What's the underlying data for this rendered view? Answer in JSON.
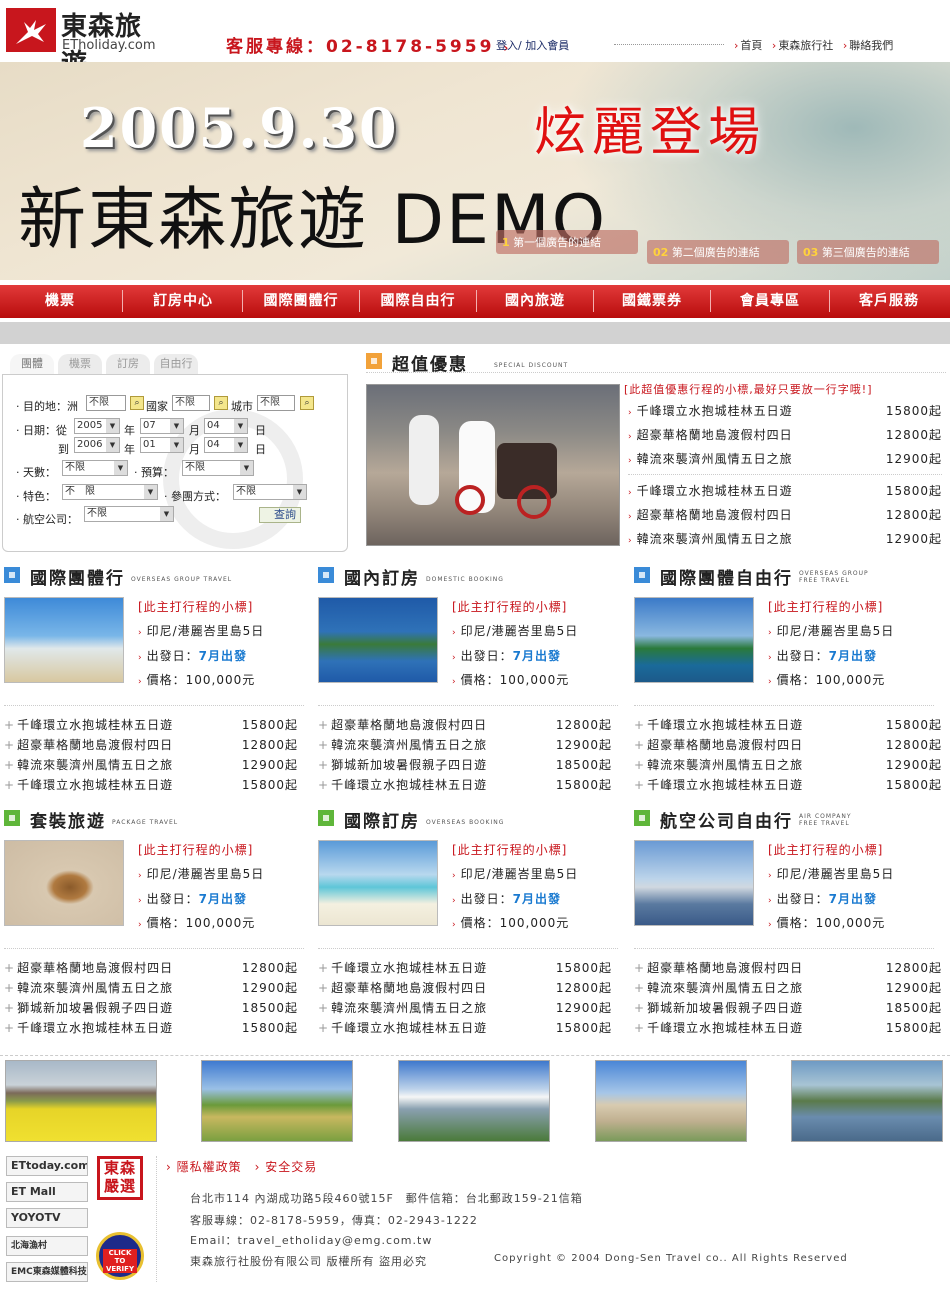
{
  "brand": {
    "name_zh": "東森旅遊",
    "name_en": "ETholiday.com"
  },
  "header": {
    "hotline": "客服專線：02-8178-5959",
    "login": "登入",
    "join": "加入會員",
    "nav": [
      "首頁",
      "東森旅行社",
      "聯絡我們"
    ]
  },
  "banner": {
    "date": "2005.9.30",
    "show": "炫麗登場",
    "title": "新東森旅遊 DEMO",
    "ads": [
      {
        "num": "1",
        "text": "第一個廣告的連結"
      },
      {
        "num": "02",
        "text": "第二個廣告的連結"
      },
      {
        "num": "03",
        "text": "第三個廣告的連結"
      }
    ]
  },
  "menu": [
    "機票",
    "訂房中心",
    "國際團體行",
    "國際自由行",
    "國內旅遊",
    "國鐵票券",
    "會員專區",
    "客戶服務"
  ],
  "search": {
    "tabs": [
      "團體",
      "機票",
      "訂房",
      "自由行"
    ],
    "dest_label": "目的地：洲",
    "dest_continent": "不限",
    "country_label": "國家",
    "country": "不限",
    "city_label": "城市",
    "city": "不限",
    "date_label": "日期：從",
    "to_label": "到",
    "from_year": "2005",
    "from_month": "07",
    "from_day": "04",
    "to_year": "2006",
    "to_month": "01",
    "to_day": "04",
    "year_unit": "年",
    "month_unit": "月",
    "day_unit": "日",
    "days_label": "天數：",
    "days": "不限",
    "budget_label": "預算：",
    "budget": "不限",
    "feature_label": "特色：",
    "feature": "不　限",
    "join_label": "參團方式：",
    "join": "不限",
    "airline_label": "航空公司：",
    "airline": "不限",
    "query": "查詢"
  },
  "special": {
    "title": "超值優惠",
    "en": "SPECIAL DISCOUNT",
    "subtitle": "[此超值優惠行程的小標,最好只要放一行字哦!]",
    "items": [
      {
        "name": "千峰環立水抱城桂林五日遊",
        "price": "15800起"
      },
      {
        "name": "超豪華格蘭地島渡假村四日",
        "price": "12800起"
      },
      {
        "name": "韓流來襲濟州風情五日之旅",
        "price": "12900起"
      },
      {
        "name": "千峰環立水抱城桂林五日遊",
        "price": "15800起"
      },
      {
        "name": "超豪華格蘭地島渡假村四日",
        "price": "12800起"
      },
      {
        "name": "韓流來襲濟州風情五日之旅",
        "price": "12900起"
      }
    ]
  },
  "sections": [
    {
      "title": "國際團體行",
      "en": [
        "OVERSEAS GROUP TRAVEL"
      ],
      "color": "#3a8bd8",
      "tag": "[此主打行程的小標]",
      "trip": "印尼/港麗峇里島5日",
      "depart_label": "出發日：",
      "depart": "7月出發",
      "price": "價格：100,000元",
      "items": [
        {
          "name": "千峰環立水抱城桂林五日遊",
          "price": "15800起"
        },
        {
          "name": "超豪華格蘭地島渡假村四日",
          "price": "12800起"
        },
        {
          "name": "韓流來襲濟州風情五日之旅",
          "price": "12900起"
        },
        {
          "name": "千峰環立水抱城桂林五日遊",
          "price": "15800起"
        }
      ]
    },
    {
      "title": "國內訂房",
      "en": [
        "DOMESTIC BOOKING"
      ],
      "color": "#3a8bd8",
      "tag": "[此主打行程的小標]",
      "trip": "印尼/港麗峇里島5日",
      "depart_label": "出發日：",
      "depart": "7月出發",
      "price": "價格：100,000元",
      "items": [
        {
          "name": "超豪華格蘭地島渡假村四日",
          "price": "12800起"
        },
        {
          "name": "韓流來襲濟州風情五日之旅",
          "price": "12900起"
        },
        {
          "name": "獅城新加坡暑假親子四日遊",
          "price": "18500起"
        },
        {
          "name": "千峰環立水抱城桂林五日遊",
          "price": "15800起"
        }
      ]
    },
    {
      "title": "國際團體自由行",
      "en": [
        "OVERSEAS GROUP",
        "FREE TRAVEL"
      ],
      "color": "#3a8bd8",
      "tag": "[此主打行程的小標]",
      "trip": "印尼/港麗峇里島5日",
      "depart_label": "出發日：",
      "depart": "7月出發",
      "price": "價格：100,000元",
      "items": [
        {
          "name": "千峰環立水抱城桂林五日遊",
          "price": "15800起"
        },
        {
          "name": "超豪華格蘭地島渡假村四日",
          "price": "12800起"
        },
        {
          "name": "韓流來襲濟州風情五日之旅",
          "price": "12900起"
        },
        {
          "name": "千峰環立水抱城桂林五日遊",
          "price": "15800起"
        }
      ]
    },
    {
      "title": "套裝旅遊",
      "en": [
        "PACKAGE TRAVEL"
      ],
      "color": "#5fb63a",
      "tag": "[此主打行程的小標]",
      "trip": "印尼/港麗峇里島5日",
      "depart_label": "出發日：",
      "depart": "7月出發",
      "price": "價格：100,000元",
      "items": [
        {
          "name": "超豪華格蘭地島渡假村四日",
          "price": "12800起"
        },
        {
          "name": "韓流來襲濟州風情五日之旅",
          "price": "12900起"
        },
        {
          "name": "獅城新加坡暑假親子四日遊",
          "price": "18500起"
        },
        {
          "name": "千峰環立水抱城桂林五日遊",
          "price": "15800起"
        }
      ]
    },
    {
      "title": "國際訂房",
      "en": [
        "OVERSEAS BOOKING"
      ],
      "color": "#5fb63a",
      "tag": "[此主打行程的小標]",
      "trip": "印尼/港麗峇里島5日",
      "depart_label": "出發日：",
      "depart": "7月出發",
      "price": "價格：100,000元",
      "items": [
        {
          "name": "千峰環立水抱城桂林五日遊",
          "price": "15800起"
        },
        {
          "name": "超豪華格蘭地島渡假村四日",
          "price": "12800起"
        },
        {
          "name": "韓流來襲濟州風情五日之旅",
          "price": "12900起"
        },
        {
          "name": "千峰環立水抱城桂林五日遊",
          "price": "15800起"
        }
      ]
    },
    {
      "title": "航空公司自由行",
      "en": [
        "AIR COMPANY",
        "FREE TRAVEL"
      ],
      "color": "#5fb63a",
      "tag": "[此主打行程的小標]",
      "trip": "印尼/港麗峇里島5日",
      "depart_label": "出發日：",
      "depart": "7月出發",
      "price": "價格：100,000元",
      "items": [
        {
          "name": "超豪華格蘭地島渡假村四日",
          "price": "12800起"
        },
        {
          "name": "韓流來襲濟州風情五日之旅",
          "price": "12900起"
        },
        {
          "name": "獅城新加坡暑假親子四日遊",
          "price": "18500起"
        },
        {
          "name": "千峰環立水抱城桂林五日遊",
          "price": "15800起"
        }
      ]
    }
  ],
  "footer": {
    "partners": [
      "ETtoday.com",
      "ET Mall",
      "YOYOTV",
      "北海漁村",
      "EMC東森媒體科技"
    ],
    "stamp": "東森嚴選",
    "verify": "CLICK TO VERIFY",
    "links": [
      "隱私權政策",
      "安全交易"
    ],
    "address": "台北市114 內湖成功路5段460號15F　郵件信箱：台北郵政159-21信箱",
    "service": "客服專線：02-8178-5959，傳真：02-2943-1222",
    "email": "Email：travel_etholiday@emg.com.tw",
    "company": "東森旅行社股份有限公司 版權所有 盜用必究",
    "copyright": "Copyright © 2004 Dong-Sen Travel co.. All Rights Reserved"
  },
  "colors": {
    "brand_red": "#c8161d",
    "menu_red": "#d01c1c",
    "link_blue": "#1a7ad0"
  }
}
